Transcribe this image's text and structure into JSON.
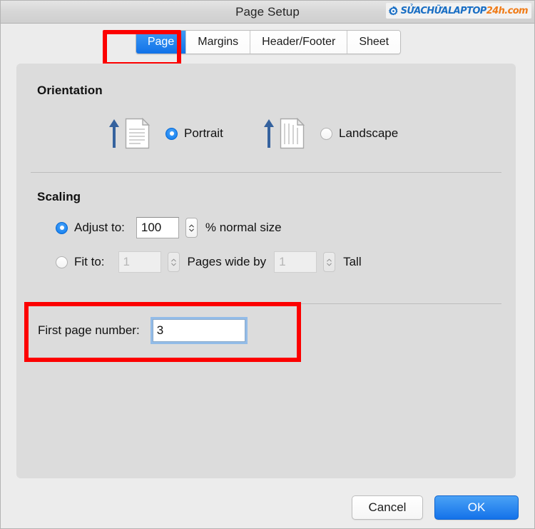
{
  "window": {
    "title": "Page Setup"
  },
  "watermark": {
    "icon": "gear-icon",
    "part1": "SỬACHỮALAPTOP",
    "part2": "24h",
    "part3": ".com",
    "color_blue": "#1a6fc4",
    "color_orange": "#f07c18"
  },
  "tabs": [
    {
      "label": "Page",
      "active": true
    },
    {
      "label": "Margins",
      "active": false
    },
    {
      "label": "Header/Footer",
      "active": false
    },
    {
      "label": "Sheet",
      "active": false
    }
  ],
  "orientation": {
    "title": "Orientation",
    "options": [
      {
        "label": "Portrait",
        "selected": true,
        "icon": "portrait-page-icon"
      },
      {
        "label": "Landscape",
        "selected": false,
        "icon": "landscape-page-icon"
      }
    ]
  },
  "scaling": {
    "title": "Scaling",
    "adjust": {
      "label": "Adjust to:",
      "selected": true,
      "value": "100",
      "suffix": "% normal size"
    },
    "fit": {
      "label": "Fit to:",
      "selected": false,
      "enabled": false,
      "wide_value": "1",
      "middle_label": "Pages wide by",
      "tall_value": "1",
      "tall_label": "Tall"
    }
  },
  "first_page": {
    "label": "First page number:",
    "value": "3"
  },
  "footer": {
    "cancel_label": "Cancel",
    "ok_label": "OK"
  },
  "annotations": {
    "highlight_color": "#fc0000"
  }
}
